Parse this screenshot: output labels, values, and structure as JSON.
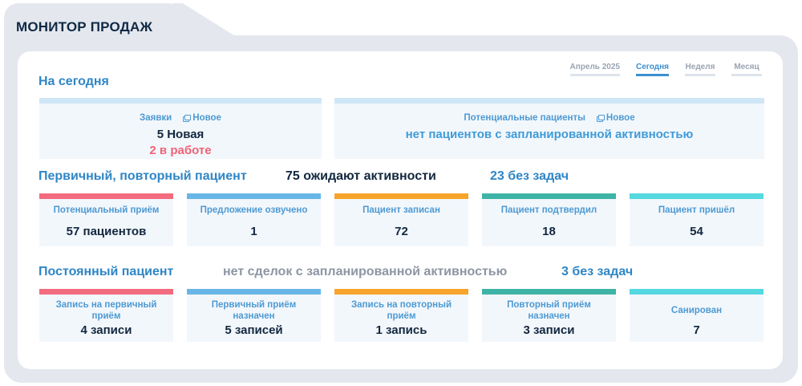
{
  "header": {
    "title": "МОНИТОР ПРОДАЖ"
  },
  "period_tabs": [
    {
      "label": "Апрель 2025",
      "active": false
    },
    {
      "label": "Сегодня",
      "active": true
    },
    {
      "label": "Неделя",
      "active": false
    },
    {
      "label": "Месяц",
      "active": false
    }
  ],
  "today": {
    "title": "На сегодня",
    "requests": {
      "label": "Заявки",
      "new_label": "Новое",
      "new_value": "5 Новая",
      "in_progress": "2 в работе"
    },
    "potential": {
      "label": "Потенциальные пациенты",
      "new_label": "Новое",
      "message": "нет пациентов с запланированной активностью"
    }
  },
  "primary": {
    "title": "Первичный, повторный пациент",
    "waiting": "75 ожидают активности",
    "no_tasks": "23 без задач",
    "tiles": [
      {
        "label": "Потенциальный приём",
        "value": "57 пациентов",
        "color": "#f26b7e"
      },
      {
        "label": "Предложение озвучено",
        "value": "1",
        "color": "#68b6e8"
      },
      {
        "label": "Пациент записан",
        "value": "72",
        "color": "#f7a42c"
      },
      {
        "label": "Пациент подтвердил",
        "value": "18",
        "color": "#3fb4a6"
      },
      {
        "label": "Пациент пришёл",
        "value": "54",
        "color": "#55d8df"
      }
    ]
  },
  "permanent": {
    "title": "Постоянный пациент",
    "no_deals": "нет сделок с запланированной активностью",
    "no_tasks": "3 без задач",
    "tiles": [
      {
        "label": "Запись на первичный приём",
        "value": "4 записи",
        "color": "#f26b7e"
      },
      {
        "label": "Первичный приём назначен",
        "value": "5 записей",
        "color": "#68b6e8"
      },
      {
        "label": "Запись на повторный приём",
        "value": "1 запись",
        "color": "#f7a42c"
      },
      {
        "label": "Повторный приём назначен",
        "value": "3 записи",
        "color": "#3fb4a6"
      },
      {
        "label": "Санирован",
        "value": "7",
        "color": "#55d8df"
      }
    ]
  }
}
